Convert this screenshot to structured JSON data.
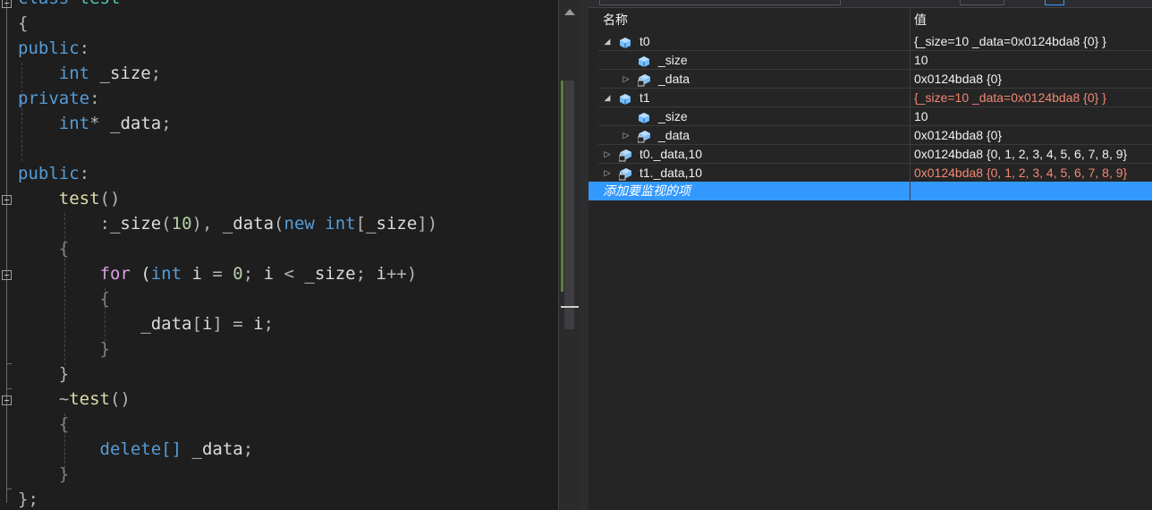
{
  "editor": {
    "lines": [
      {
        "tokens": [
          {
            "t": "class",
            "c": "kw"
          },
          {
            "t": " "
          },
          {
            "t": "test",
            "c": "cls"
          }
        ]
      },
      {
        "tokens": [
          {
            "t": "{",
            "c": "pl"
          }
        ]
      },
      {
        "tokens": [
          {
            "t": "public",
            "c": "kw"
          },
          {
            "t": ":",
            "c": "pl"
          }
        ]
      },
      {
        "tokens": [
          {
            "t": "    "
          },
          {
            "t": "int",
            "c": "kw"
          },
          {
            "t": " "
          },
          {
            "t": "_size",
            "c": "id"
          },
          {
            "t": ";",
            "c": "pl"
          }
        ]
      },
      {
        "tokens": [
          {
            "t": "private",
            "c": "kw"
          },
          {
            "t": ":",
            "c": "pl"
          }
        ]
      },
      {
        "tokens": [
          {
            "t": "    "
          },
          {
            "t": "int",
            "c": "kw"
          },
          {
            "t": "*",
            "c": "pl"
          },
          {
            "t": " "
          },
          {
            "t": "_data",
            "c": "id"
          },
          {
            "t": ";",
            "c": "pl"
          }
        ]
      },
      {
        "tokens": []
      },
      {
        "tokens": [
          {
            "t": "public",
            "c": "kw"
          },
          {
            "t": ":",
            "c": "pl"
          }
        ]
      },
      {
        "tokens": [
          {
            "t": "    "
          },
          {
            "t": "test",
            "c": "fn"
          },
          {
            "t": "()",
            "c": "pl"
          }
        ]
      },
      {
        "tokens": [
          {
            "t": "        "
          },
          {
            "t": ":",
            "c": "pl"
          },
          {
            "t": "_size",
            "c": "id"
          },
          {
            "t": "(",
            "c": "pl"
          },
          {
            "t": "10",
            "c": "num"
          },
          {
            "t": "), ",
            "c": "pl"
          },
          {
            "t": "_data",
            "c": "id"
          },
          {
            "t": "(",
            "c": "pl"
          },
          {
            "t": "new",
            "c": "kw"
          },
          {
            "t": " "
          },
          {
            "t": "int",
            "c": "kw"
          },
          {
            "t": "[",
            "c": "pl"
          },
          {
            "t": "_size",
            "c": "id"
          },
          {
            "t": "])",
            "c": "pl"
          }
        ]
      },
      {
        "tokens": [
          {
            "t": "    "
          },
          {
            "t": "{",
            "c": "br"
          }
        ]
      },
      {
        "tokens": [
          {
            "t": "        "
          },
          {
            "t": "for",
            "c": "ctl"
          },
          {
            "t": " ("
          },
          {
            "t": "int",
            "c": "kw"
          },
          {
            "t": " "
          },
          {
            "t": "i",
            "c": "id"
          },
          {
            "t": " = ",
            "c": "pl"
          },
          {
            "t": "0",
            "c": "num"
          },
          {
            "t": "; ",
            "c": "pl"
          },
          {
            "t": "i",
            "c": "id"
          },
          {
            "t": " < ",
            "c": "pl"
          },
          {
            "t": "_size",
            "c": "id"
          },
          {
            "t": "; ",
            "c": "pl"
          },
          {
            "t": "i",
            "c": "id"
          },
          {
            "t": "++)",
            "c": "pl"
          }
        ]
      },
      {
        "tokens": [
          {
            "t": "        "
          },
          {
            "t": "{",
            "c": "br"
          }
        ]
      },
      {
        "tokens": [
          {
            "t": "            "
          },
          {
            "t": "_data",
            "c": "id"
          },
          {
            "t": "[",
            "c": "pl"
          },
          {
            "t": "i",
            "c": "id"
          },
          {
            "t": "] = ",
            "c": "pl"
          },
          {
            "t": "i",
            "c": "id"
          },
          {
            "t": ";",
            "c": "pl"
          }
        ]
      },
      {
        "tokens": [
          {
            "t": "        "
          },
          {
            "t": "}",
            "c": "br"
          }
        ]
      },
      {
        "tokens": [
          {
            "t": "    "
          },
          {
            "t": "}",
            "c": "pl"
          }
        ]
      },
      {
        "tokens": [
          {
            "t": "    "
          },
          {
            "t": "~",
            "c": "pl"
          },
          {
            "t": "test",
            "c": "fn"
          },
          {
            "t": "()",
            "c": "pl"
          }
        ]
      },
      {
        "tokens": [
          {
            "t": "    "
          },
          {
            "t": "{",
            "c": "br"
          }
        ]
      },
      {
        "tokens": [
          {
            "t": "        "
          },
          {
            "t": "delete",
            "c": "kw"
          },
          {
            "t": "[]",
            "c": "kw"
          },
          {
            "t": " "
          },
          {
            "t": "_data",
            "c": "id"
          },
          {
            "t": ";",
            "c": "pl"
          }
        ]
      },
      {
        "tokens": [
          {
            "t": "    "
          },
          {
            "t": "}",
            "c": "br"
          }
        ]
      },
      {
        "tokens": [
          {
            "t": "};",
            "c": "pl"
          }
        ]
      }
    ]
  },
  "watch": {
    "header": {
      "name": "名称",
      "value": "值"
    },
    "rows": [
      {
        "level": 0,
        "expander": "expanded",
        "icon": "object",
        "name": "t0",
        "value": "{_size=10 _data=0x0124bda8 {0} }",
        "changed": false
      },
      {
        "level": 1,
        "expander": "none",
        "icon": "field",
        "name": "_size",
        "value": "10",
        "changed": false
      },
      {
        "level": 1,
        "expander": "collapsed",
        "icon": "private-field",
        "name": "_data",
        "value": "0x0124bda8 {0}",
        "changed": false
      },
      {
        "level": 0,
        "expander": "expanded",
        "icon": "object",
        "name": "t1",
        "value": "{_size=10 _data=0x0124bda8 {0} }",
        "changed": true
      },
      {
        "level": 1,
        "expander": "none",
        "icon": "field",
        "name": "_size",
        "value": "10",
        "changed": false
      },
      {
        "level": 1,
        "expander": "collapsed",
        "icon": "private-field",
        "name": "_data",
        "value": "0x0124bda8 {0}",
        "changed": false
      },
      {
        "level": 0,
        "expander": "collapsed",
        "icon": "private-field",
        "name": "t0._data,10",
        "value": "0x0124bda8 {0, 1, 2, 3, 4, 5, 6, 7, 8, 9}",
        "changed": false
      },
      {
        "level": 0,
        "expander": "collapsed",
        "icon": "private-field",
        "name": "t1._data,10",
        "value": "0x0124bda8 {0, 1, 2, 3, 4, 5, 6, 7, 8, 9}",
        "changed": true
      }
    ],
    "add_item_label": "添加要监视的项"
  }
}
